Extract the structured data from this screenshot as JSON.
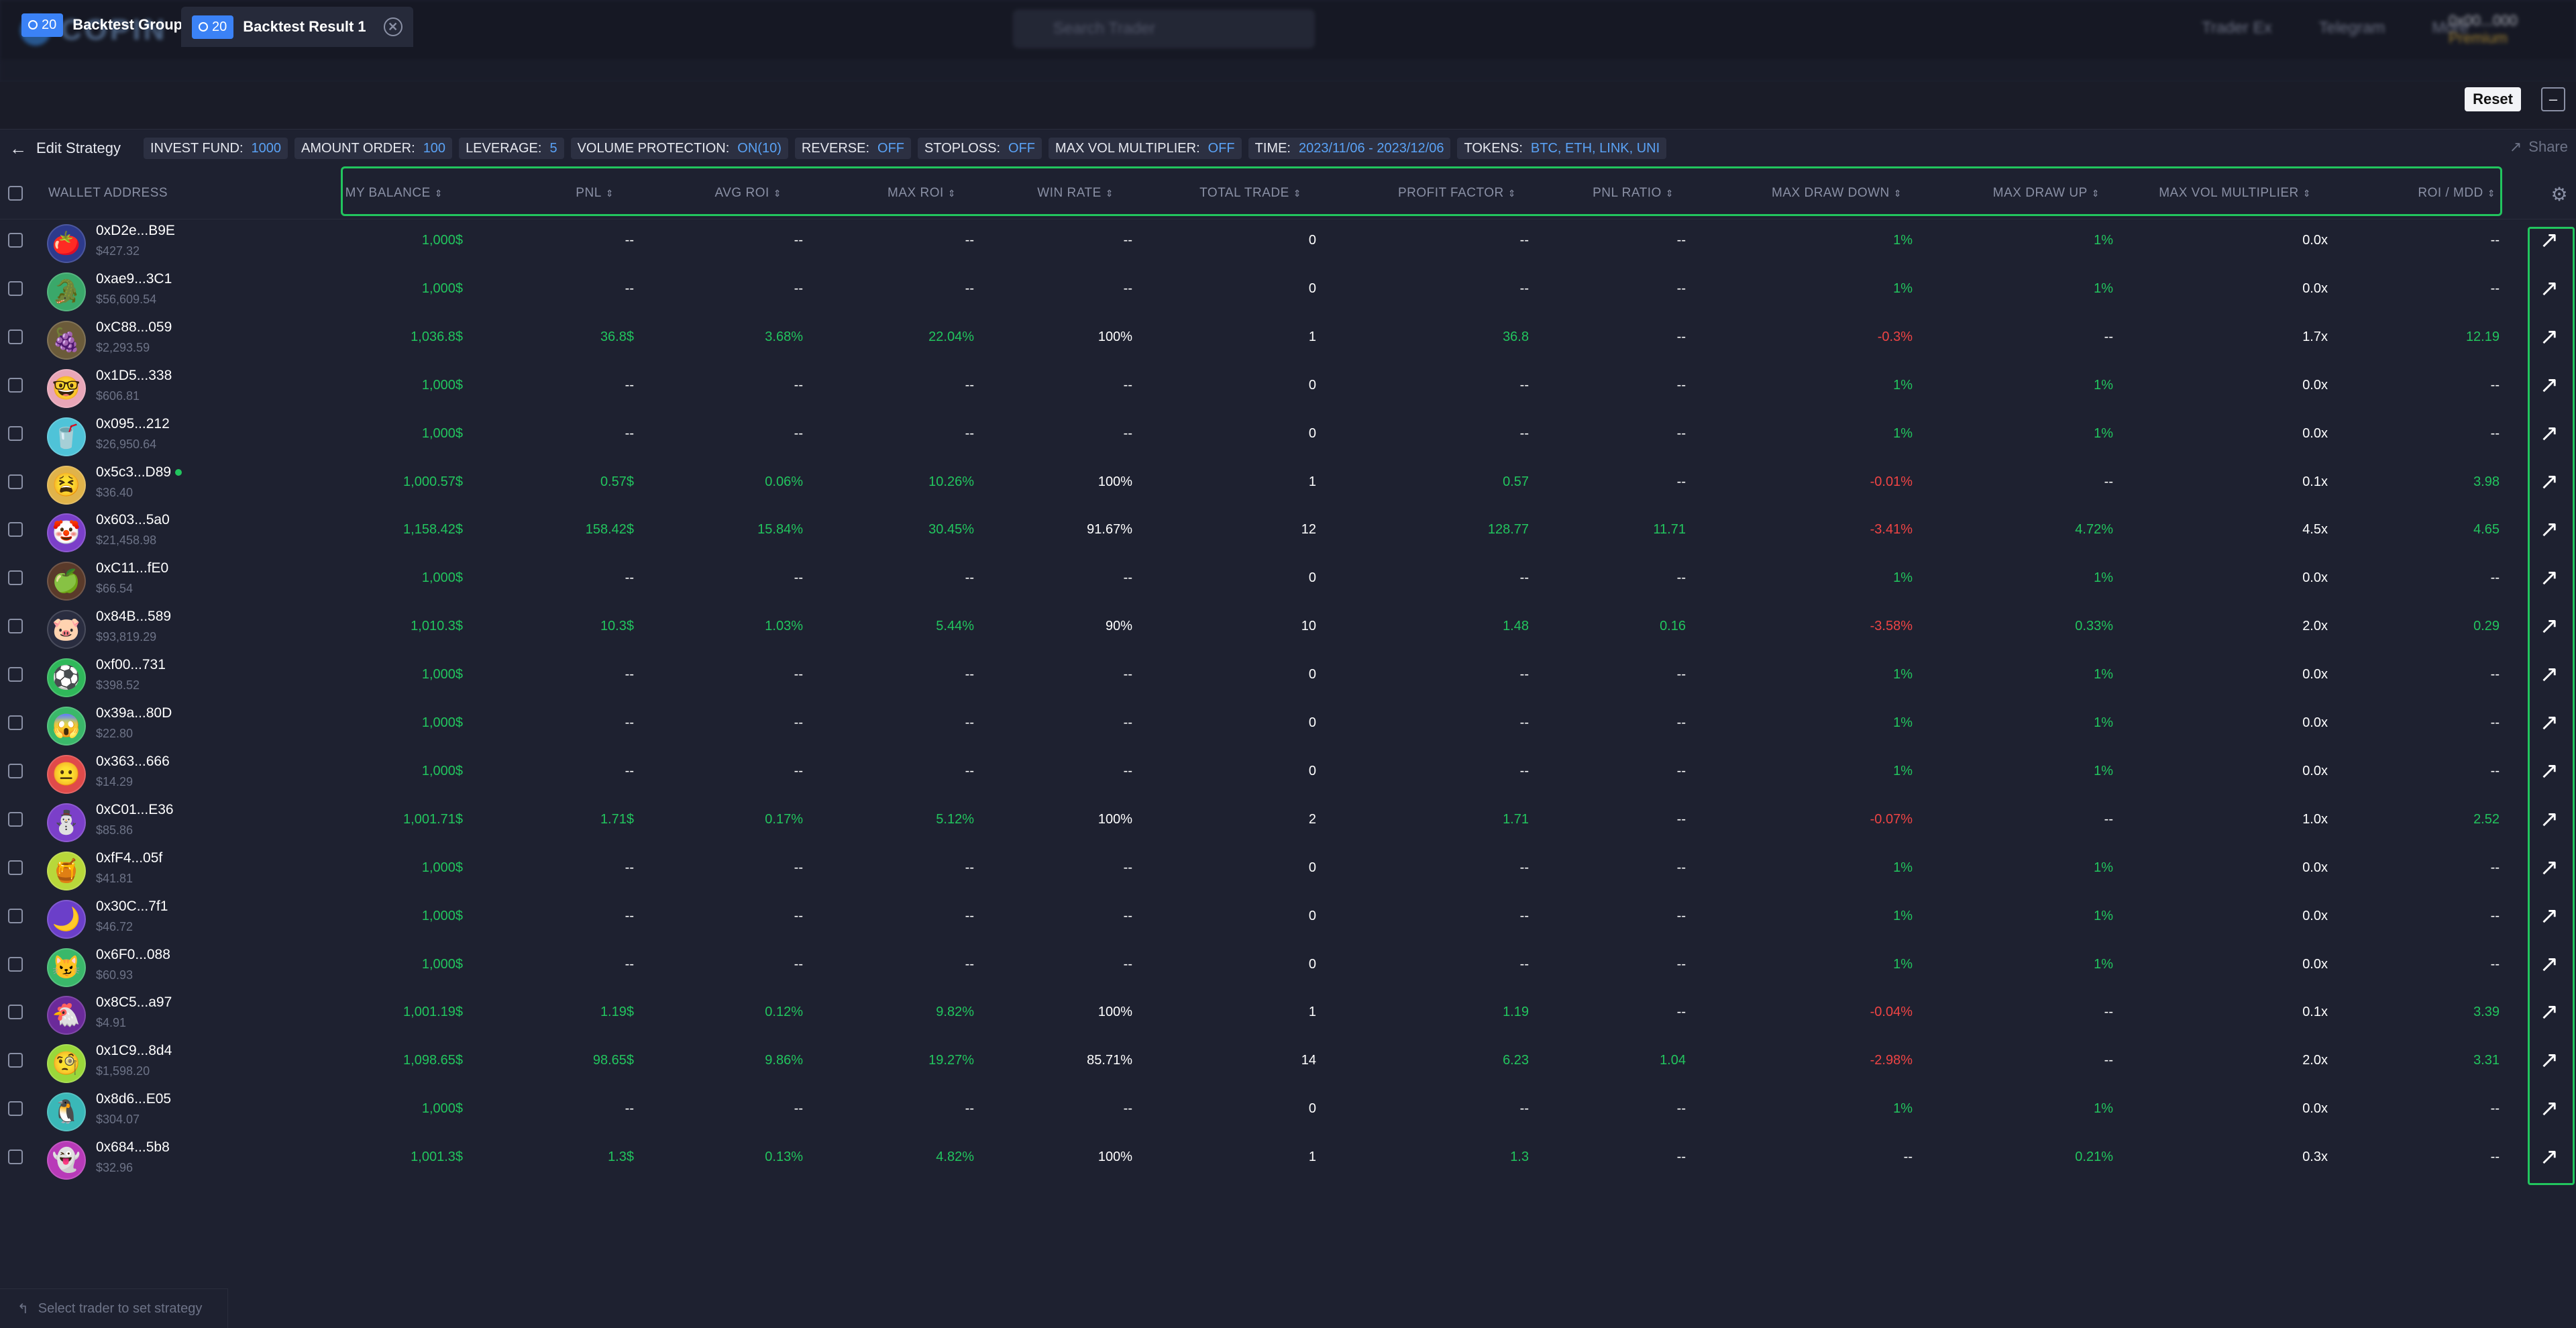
{
  "topbar": {
    "logo_text": "COPIN",
    "search_placeholder": "Search Trader",
    "nav": [
      "Trader Ex",
      "Telegram",
      "More"
    ],
    "user": "0x00...000",
    "plan": "Premium"
  },
  "tabs": [
    {
      "count": "20",
      "label": "Backtest Group"
    },
    {
      "count": "20",
      "label": "Backtest Result 1"
    }
  ],
  "actions": {
    "reset": "Reset",
    "minimize": "–",
    "share": "Share",
    "edit_strategy": "Edit Strategy"
  },
  "filters": [
    {
      "label": "INVEST FUND:",
      "value": "1000"
    },
    {
      "label": "AMOUNT ORDER:",
      "value": "100"
    },
    {
      "label": "LEVERAGE:",
      "value": "5"
    },
    {
      "label": "VOLUME PROTECTION:",
      "value": "ON(10)"
    },
    {
      "label": "REVERSE:",
      "value": "OFF"
    },
    {
      "label": "STOPLOSS:",
      "value": "OFF"
    },
    {
      "label": "MAX VOL MULTIPLIER:",
      "value": "OFF"
    },
    {
      "label": "TIME:",
      "value": "2023/11/06 - 2023/12/06"
    },
    {
      "label": "TOKENS:",
      "value": "BTC, ETH, LINK, UNI"
    }
  ],
  "columns": [
    "WALLET ADDRESS",
    "MY BALANCE",
    "PNL",
    "AVG ROI",
    "MAX ROI",
    "WIN RATE",
    "TOTAL TRADE",
    "PROFIT FACTOR",
    "PNL RATIO",
    "MAX DRAW DOWN",
    "MAX DRAW UP",
    "MAX VOL MULTIPLIER",
    "ROI / MDD"
  ],
  "rows": [
    {
      "addr": "0xD2e...B9E",
      "bal": "$427.32",
      "avatar": "🍅",
      "bg": "#2d3a8c",
      "online": false,
      "cells": [
        "1,000$",
        "--",
        "--",
        "--",
        "--",
        "0",
        "--",
        "--",
        "1%",
        "1%",
        "0.0x",
        "--"
      ],
      "colors": [
        "g",
        "w",
        "w",
        "w",
        "w",
        "w",
        "w",
        "w",
        "g",
        "g",
        "w",
        "w"
      ]
    },
    {
      "addr": "0xae9...3C1",
      "bal": "$56,609.54",
      "avatar": "🐊",
      "bg": "#3aa86a",
      "online": false,
      "cells": [
        "1,000$",
        "--",
        "--",
        "--",
        "--",
        "0",
        "--",
        "--",
        "1%",
        "1%",
        "0.0x",
        "--"
      ],
      "colors": [
        "g",
        "w",
        "w",
        "w",
        "w",
        "w",
        "w",
        "w",
        "g",
        "g",
        "w",
        "w"
      ]
    },
    {
      "addr": "0xC88...059",
      "bal": "$2,293.59",
      "avatar": "🍇",
      "bg": "#6b5b3a",
      "online": false,
      "cells": [
        "1,036.8$",
        "36.8$",
        "3.68%",
        "22.04%",
        "100%",
        "1",
        "36.8",
        "--",
        "-0.3%",
        "--",
        "1.7x",
        "12.19"
      ],
      "colors": [
        "g",
        "g",
        "g",
        "g",
        "w",
        "w",
        "g",
        "w",
        "r",
        "w",
        "w",
        "g"
      ]
    },
    {
      "addr": "0x1D5...338",
      "bal": "$606.81",
      "avatar": "🤓",
      "bg": "#e8a6b8",
      "online": false,
      "cells": [
        "1,000$",
        "--",
        "--",
        "--",
        "--",
        "0",
        "--",
        "--",
        "1%",
        "1%",
        "0.0x",
        "--"
      ],
      "colors": [
        "g",
        "w",
        "w",
        "w",
        "w",
        "w",
        "w",
        "w",
        "g",
        "g",
        "w",
        "w"
      ]
    },
    {
      "addr": "0x095...212",
      "bal": "$26,950.64",
      "avatar": "🥤",
      "bg": "#4fc3d8",
      "online": false,
      "cells": [
        "1,000$",
        "--",
        "--",
        "--",
        "--",
        "0",
        "--",
        "--",
        "1%",
        "1%",
        "0.0x",
        "--"
      ],
      "colors": [
        "g",
        "w",
        "w",
        "w",
        "w",
        "w",
        "w",
        "w",
        "g",
        "g",
        "w",
        "w"
      ]
    },
    {
      "addr": "0x5c3...D89",
      "bal": "$36.40",
      "avatar": "😫",
      "bg": "#e0b34a",
      "online": true,
      "cells": [
        "1,000.57$",
        "0.57$",
        "0.06%",
        "10.26%",
        "100%",
        "1",
        "0.57",
        "--",
        "-0.01%",
        "--",
        "0.1x",
        "3.98"
      ],
      "colors": [
        "g",
        "g",
        "g",
        "g",
        "w",
        "w",
        "g",
        "w",
        "r",
        "w",
        "w",
        "g"
      ]
    },
    {
      "addr": "0x603...5a0",
      "bal": "$21,458.98",
      "avatar": "🤡",
      "bg": "#7b3fc9",
      "online": false,
      "cells": [
        "1,158.42$",
        "158.42$",
        "15.84%",
        "30.45%",
        "91.67%",
        "12",
        "128.77",
        "11.71",
        "-3.41%",
        "4.72%",
        "4.5x",
        "4.65"
      ],
      "colors": [
        "g",
        "g",
        "g",
        "g",
        "w",
        "w",
        "g",
        "g",
        "r",
        "g",
        "w",
        "g"
      ]
    },
    {
      "addr": "0xC11...fE0",
      "bal": "$66.54",
      "avatar": "🍏",
      "bg": "#5a3a2a",
      "online": false,
      "cells": [
        "1,000$",
        "--",
        "--",
        "--",
        "--",
        "0",
        "--",
        "--",
        "1%",
        "1%",
        "0.0x",
        "--"
      ],
      "colors": [
        "g",
        "w",
        "w",
        "w",
        "w",
        "w",
        "w",
        "w",
        "g",
        "g",
        "w",
        "w"
      ]
    },
    {
      "addr": "0x84B...589",
      "bal": "$93,819.29",
      "avatar": "🐷",
      "bg": "#2a2d40",
      "online": false,
      "cells": [
        "1,010.3$",
        "10.3$",
        "1.03%",
        "5.44%",
        "90%",
        "10",
        "1.48",
        "0.16",
        "-3.58%",
        "0.33%",
        "2.0x",
        "0.29"
      ],
      "colors": [
        "g",
        "g",
        "g",
        "g",
        "w",
        "w",
        "g",
        "g",
        "r",
        "g",
        "w",
        "g"
      ]
    },
    {
      "addr": "0xf00...731",
      "bal": "$398.52",
      "avatar": "⚽",
      "bg": "#2fb85a",
      "online": false,
      "cells": [
        "1,000$",
        "--",
        "--",
        "--",
        "--",
        "0",
        "--",
        "--",
        "1%",
        "1%",
        "0.0x",
        "--"
      ],
      "colors": [
        "g",
        "w",
        "w",
        "w",
        "w",
        "w",
        "w",
        "w",
        "g",
        "g",
        "w",
        "w"
      ]
    },
    {
      "addr": "0x39a...80D",
      "bal": "$22.80",
      "avatar": "😱",
      "bg": "#3ab86a",
      "online": false,
      "cells": [
        "1,000$",
        "--",
        "--",
        "--",
        "--",
        "0",
        "--",
        "--",
        "1%",
        "1%",
        "0.0x",
        "--"
      ],
      "colors": [
        "g",
        "w",
        "w",
        "w",
        "w",
        "w",
        "w",
        "w",
        "g",
        "g",
        "w",
        "w"
      ]
    },
    {
      "addr": "0x363...666",
      "bal": "$14.29",
      "avatar": "😐",
      "bg": "#e04a4a",
      "online": false,
      "cells": [
        "1,000$",
        "--",
        "--",
        "--",
        "--",
        "0",
        "--",
        "--",
        "1%",
        "1%",
        "0.0x",
        "--"
      ],
      "colors": [
        "g",
        "w",
        "w",
        "w",
        "w",
        "w",
        "w",
        "w",
        "g",
        "g",
        "w",
        "w"
      ]
    },
    {
      "addr": "0xC01...E36",
      "bal": "$85.86",
      "avatar": "⛄",
      "bg": "#7b3fc9",
      "online": false,
      "cells": [
        "1,001.71$",
        "1.71$",
        "0.17%",
        "5.12%",
        "100%",
        "2",
        "1.71",
        "--",
        "-0.07%",
        "--",
        "1.0x",
        "2.52"
      ],
      "colors": [
        "g",
        "g",
        "g",
        "g",
        "w",
        "w",
        "g",
        "w",
        "r",
        "w",
        "w",
        "g"
      ]
    },
    {
      "addr": "0xfF4...05f",
      "bal": "$41.81",
      "avatar": "🍯",
      "bg": "#b8d83a",
      "online": false,
      "cells": [
        "1,000$",
        "--",
        "--",
        "--",
        "--",
        "0",
        "--",
        "--",
        "1%",
        "1%",
        "0.0x",
        "--"
      ],
      "colors": [
        "g",
        "w",
        "w",
        "w",
        "w",
        "w",
        "w",
        "w",
        "g",
        "g",
        "w",
        "w"
      ]
    },
    {
      "addr": "0x30C...7f1",
      "bal": "$46.72",
      "avatar": "🌙",
      "bg": "#6b3fc9",
      "online": false,
      "cells": [
        "1,000$",
        "--",
        "--",
        "--",
        "--",
        "0",
        "--",
        "--",
        "1%",
        "1%",
        "0.0x",
        "--"
      ],
      "colors": [
        "g",
        "w",
        "w",
        "w",
        "w",
        "w",
        "w",
        "w",
        "g",
        "g",
        "w",
        "w"
      ]
    },
    {
      "addr": "0x6F0...088",
      "bal": "$60.93",
      "avatar": "😼",
      "bg": "#3ab86a",
      "online": false,
      "cells": [
        "1,000$",
        "--",
        "--",
        "--",
        "--",
        "0",
        "--",
        "--",
        "1%",
        "1%",
        "0.0x",
        "--"
      ],
      "colors": [
        "g",
        "w",
        "w",
        "w",
        "w",
        "w",
        "w",
        "w",
        "g",
        "g",
        "w",
        "w"
      ]
    },
    {
      "addr": "0x8C5...a97",
      "bal": "$4.91",
      "avatar": "🐔",
      "bg": "#6b2a9a",
      "online": false,
      "cells": [
        "1,001.19$",
        "1.19$",
        "0.12%",
        "9.82%",
        "100%",
        "1",
        "1.19",
        "--",
        "-0.04%",
        "--",
        "0.1x",
        "3.39"
      ],
      "colors": [
        "g",
        "g",
        "g",
        "g",
        "w",
        "w",
        "g",
        "w",
        "r",
        "w",
        "w",
        "g"
      ]
    },
    {
      "addr": "0x1C9...8d4",
      "bal": "$1,598.20",
      "avatar": "🧐",
      "bg": "#9ad83a",
      "online": false,
      "cells": [
        "1,098.65$",
        "98.65$",
        "9.86%",
        "19.27%",
        "85.71%",
        "14",
        "6.23",
        "1.04",
        "-2.98%",
        "--",
        "2.0x",
        "3.31"
      ],
      "colors": [
        "g",
        "g",
        "g",
        "g",
        "w",
        "w",
        "g",
        "g",
        "r",
        "w",
        "w",
        "g"
      ]
    },
    {
      "addr": "0x8d6...E05",
      "bal": "$304.07",
      "avatar": "🐧",
      "bg": "#3ab8b8",
      "online": false,
      "cells": [
        "1,000$",
        "--",
        "--",
        "--",
        "--",
        "0",
        "--",
        "--",
        "1%",
        "1%",
        "0.0x",
        "--"
      ],
      "colors": [
        "g",
        "w",
        "w",
        "w",
        "w",
        "w",
        "w",
        "w",
        "g",
        "g",
        "w",
        "w"
      ]
    },
    {
      "addr": "0x684...5b8",
      "bal": "$32.96",
      "avatar": "👻",
      "bg": "#b83ab8",
      "online": false,
      "cells": [
        "1,001.3$",
        "1.3$",
        "0.13%",
        "4.82%",
        "100%",
        "1",
        "1.3",
        "--",
        "--",
        "0.21%",
        "0.3x",
        "--"
      ],
      "colors": [
        "g",
        "g",
        "g",
        "g",
        "w",
        "w",
        "g",
        "w",
        "w",
        "g",
        "w",
        "w"
      ]
    }
  ],
  "footer": {
    "hint": "Select trader to set strategy"
  }
}
